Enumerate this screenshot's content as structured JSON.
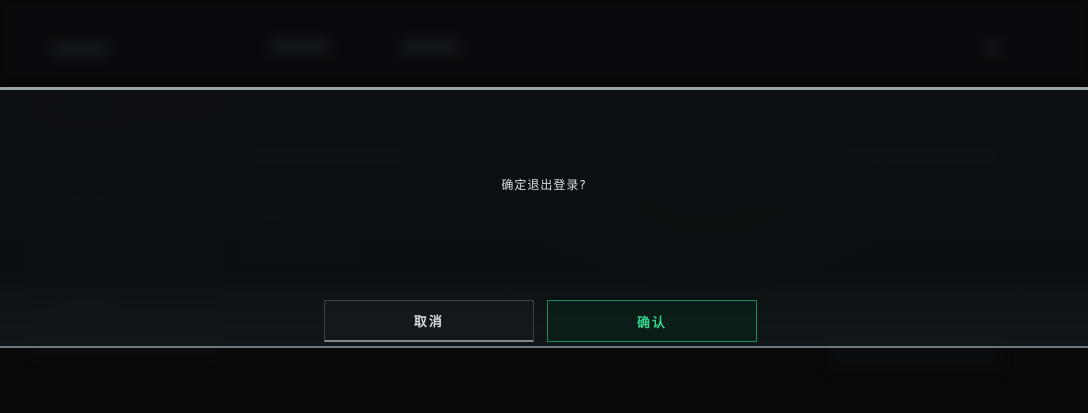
{
  "dialog": {
    "message": "确定退出登录?",
    "cancel_label": "取消",
    "confirm_label": "确认"
  },
  "colors": {
    "accent": "#34d28b",
    "accent_border": "#1f8a5e",
    "text": "#d8dcde",
    "background": "#06080a"
  }
}
